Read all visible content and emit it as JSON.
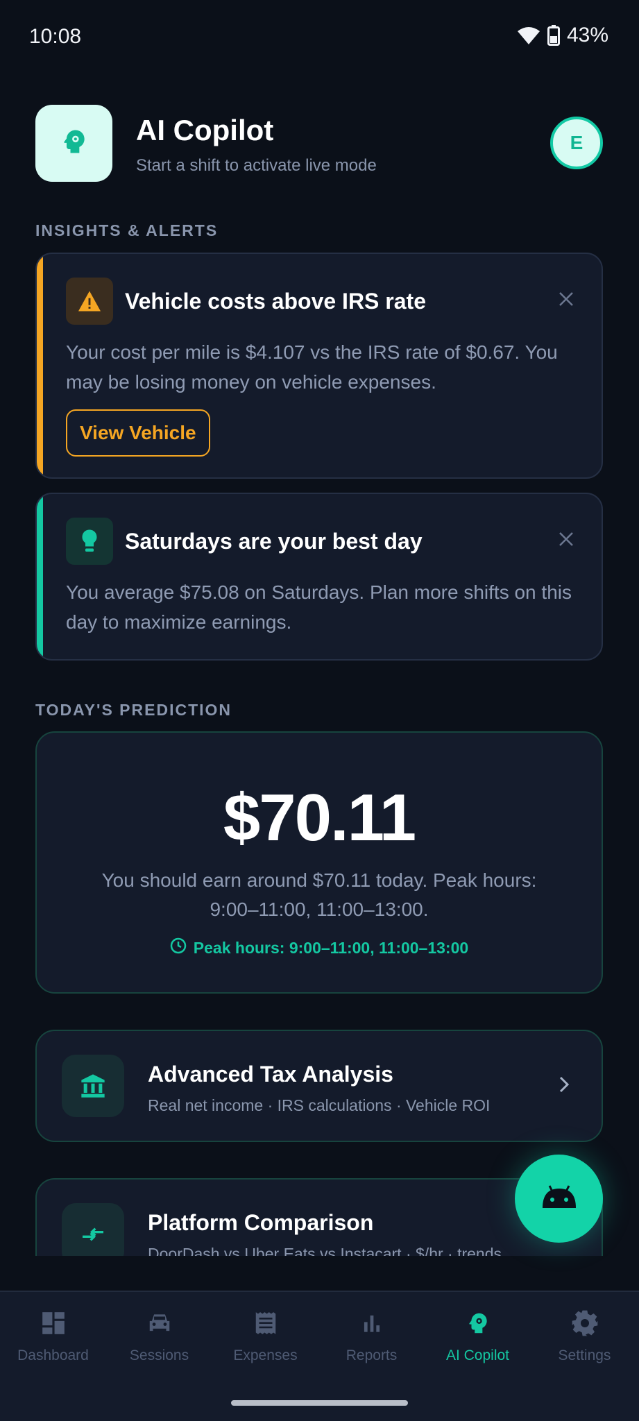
{
  "status_bar": {
    "time": "10:08",
    "battery": "43%"
  },
  "header": {
    "title": "AI Copilot",
    "subtitle": "Start a shift to activate live mode",
    "avatar_initial": "E"
  },
  "sections": {
    "insights_label": "INSIGHTS & ALERTS",
    "prediction_label": "TODAY'S PREDICTION"
  },
  "insights": [
    {
      "title": "Vehicle costs above IRS rate",
      "body": "Your cost per mile is $4.107 vs the IRS rate of $0.67. You may be losing money on vehicle expenses.",
      "action_label": "View Vehicle",
      "icon": "warning-icon",
      "accent_color": "#f5a623"
    },
    {
      "title": "Saturdays are your best day",
      "body": "You average $75.08 on Saturdays. Plan more shifts on this day to maximize earnings.",
      "icon": "lightbulb-icon",
      "accent_color": "#14c8a2"
    }
  ],
  "prediction": {
    "amount": "$70.11",
    "description": "You should earn around $70.11 today. Peak hours: 9:00–11:00, 11:00–13:00.",
    "peak_label": "Peak hours: 9:00–11:00, 11:00–13:00"
  },
  "features": [
    {
      "title": "Advanced Tax Analysis",
      "subtitle": "Real net income · IRS calculations · Vehicle ROI",
      "icon": "bank-icon"
    },
    {
      "title": "Platform Comparison",
      "subtitle": "DoorDash vs Uber Eats vs Instacart · $/hr · trends",
      "icon": "compare-arrows-icon"
    }
  ],
  "nav": [
    {
      "label": "Dashboard",
      "icon": "dashboard-icon"
    },
    {
      "label": "Sessions",
      "icon": "car-icon"
    },
    {
      "label": "Expenses",
      "icon": "receipt-icon"
    },
    {
      "label": "Reports",
      "icon": "bar-chart-icon"
    },
    {
      "label": "AI Copilot",
      "icon": "ai-head-icon",
      "active": true
    },
    {
      "label": "Settings",
      "icon": "gear-icon"
    }
  ],
  "colors": {
    "accent": "#14c8a2",
    "warning": "#f5a623",
    "background": "#0b1019",
    "card": "#141b2b"
  }
}
